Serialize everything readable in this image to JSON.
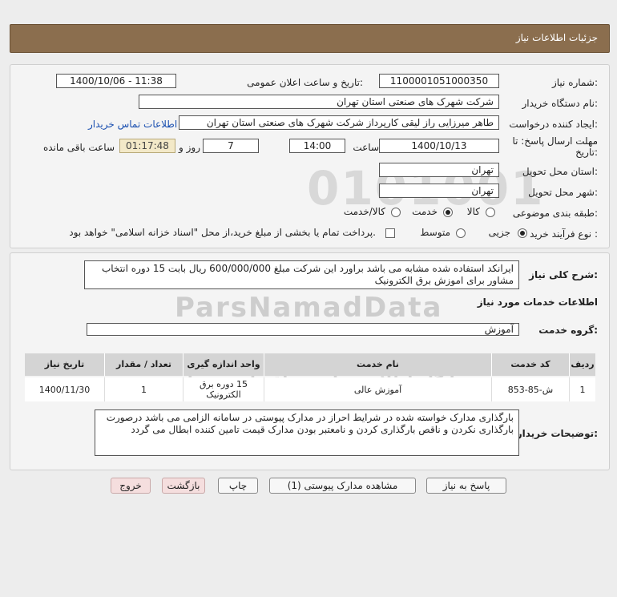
{
  "header": {
    "title": "جزئیات اطلاعات نیاز"
  },
  "form": {
    "need_number_label": "شماره نیاز:",
    "need_number": "1100001051000350",
    "announce_label": "تاریخ و ساعت اعلان عمومی:",
    "announce_value": "1400/10/06 - 11:38",
    "buyer_org_label": "نام دستگاه خریدار:",
    "buyer_org": "شرکت شهرک های صنعتی استان تهران",
    "creator_label": "ایجاد کننده درخواست:",
    "creator": "طاهر  میرزایی راز لیقی کارپرداز شرکت شهرک های صنعتی استان تهران",
    "contact_link": "اطلاعات تماس خریدار",
    "deadline_label_1": "مهلت ارسال پاسخ: تا",
    "deadline_label_2": "تاریخ:",
    "deadline_date": "1400/10/13",
    "time_label": "ساعت",
    "deadline_time": "14:00",
    "days_value": "7",
    "days_label": "روز و",
    "remaining_time": "01:17:48",
    "remaining_label": "ساعت باقی مانده",
    "province_label": "استان محل تحویل:",
    "province": "تهران",
    "city_label": "شهر محل تحویل:",
    "city": "تهران",
    "category_label": "طبقه بندی موضوعی:",
    "category_options": [
      "کالا",
      "خدمت",
      "کالا/خدمت"
    ],
    "purchase_label": "نوع فرآیند خرید :",
    "purchase_options": [
      "جزیی",
      "متوسط"
    ],
    "payment_text": "پرداخت تمام یا بخشی از مبلغ خرید،از محل \"اسناد خزانه اسلامی\" خواهد بود."
  },
  "details": {
    "summary_label": "شرح کلی نیاز:",
    "summary_text": "ایرانکد استفاده شده مشابه می باشد براورد این شرکت مبلغ 600/000/000 ریال بابت 15 دوره  انتخاب مشاور برای اموزش برق الکترونیک",
    "services_title": "اطلاعات خدمات مورد نیاز",
    "service_group_label": "گروه خدمت:",
    "service_group": "آموزش",
    "table": {
      "headers": [
        "ردیف",
        "کد خدمت",
        "نام خدمت",
        "واحد اندازه گیری",
        "تعداد / مقدار",
        "تاریخ نیاز"
      ],
      "rows": [
        [
          "1",
          "ش-85-853",
          "آموزش عالی",
          "15 دوره برق الکترونیک",
          "1",
          "1400/11/30"
        ]
      ]
    },
    "buyer_notes_label": "توضیحات خریدار:",
    "buyer_notes": "بارگذاری مدارک خواسته شده در  شرایط احراز در مدارک پیوستی  در سامانه الزامی می باشد درصورت بارگذاری نکردن و ناقص بارگذاری کردن و نامعتبر بودن مدارک قیمت تامین کننده ابطال می گردد"
  },
  "buttons": {
    "reply": "پاسخ به نیاز",
    "attachments": "مشاهده مدارک پیوستی (1)",
    "print": "چاپ",
    "back": "بازگشت",
    "exit": "خروج"
  }
}
